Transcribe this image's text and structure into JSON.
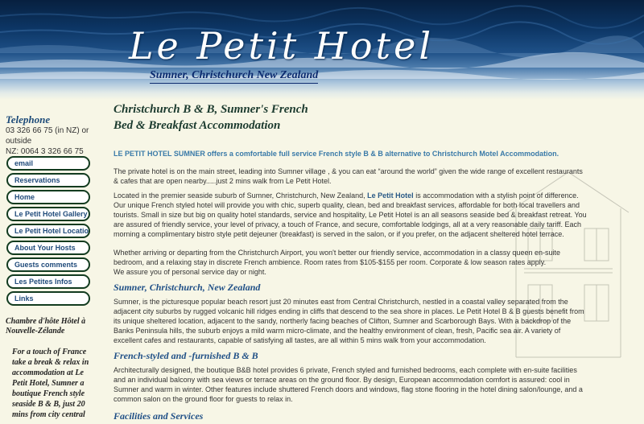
{
  "header": {
    "logo_title": "Le Petit Hotel",
    "logo_subtitle": "Sumner, Christchurch New Zealand"
  },
  "sidebar": {
    "telephone_label": "Telephone",
    "telephone_lines": [
      "03 326 66 75 (in NZ) or outside",
      "NZ: 0064 3 326 66 75"
    ],
    "nav": [
      "email",
      "Reservations",
      "Home",
      "Le Petit Hotel Gallery",
      "Le Petit Hotel Location",
      "About Your Hosts",
      "Guests comments",
      "Les Petites Infos",
      "Links"
    ],
    "chambre": "Chambre d'hôte Hôtel à Nouvelle-Zélande",
    "touch": "For a touch of France take a break & relax in accommodation at Le Petit Hotel, Sumner a boutique French style seaside B & B, just 20 mins from city central"
  },
  "main": {
    "heading_line1": "Christchurch B & B, Sumner's French",
    "heading_line2": "Bed & Breakfast Accommodation",
    "intro": "LE PETIT HOTEL SUMNER offers a comfortable full service French style B & B alternative to Christchurch Motel Accommodation.",
    "p1": "The private hotel is on the main street, leading into Sumner village , & you can eat “around the world” given the wide range of excellent restaurants & cafes that are open nearby.....just 2 mins walk from Le Petit Hotel.",
    "p2a": "Located in the premier seaside suburb of Sumner, Christchurch, New Zealand, ",
    "p2_highlight": "Le Petit Hotel",
    "p2b": " is accommodation with a stylish point of difference. Our unique French styled hotel will provide you with chic, superb quality, clean, bed and breakfast services, affordable for both local travellers and tourists. Small in size but big on quality hotel standards, service and hospitality, Le Petit Hotel is an all seasons seaside bed & breakfast retreat. You are assured of friendly service, your level of privacy, a touch of France, and secure, comfortable lodgings, all at a very reasonable daily tariff. Each morning a complimentary bistro style petit dejeuner (breakfast) is served in the salon, or if you prefer, on the adjacent sheltered hotel terrace.",
    "p3": "Whether arriving or departing from the Christchurch Airport, you won't better our friendly service, accommodation in a classy queen en-suite bedroom, and a relaxing stay in discrete French ambience. Room rates from $105-$155 per room. Corporate & low season rates apply.",
    "p3b": "We assure you of personal service day or night.",
    "h2_sumner": "Sumner, Christchurch, New Zealand",
    "p4": "Sumner, is the picturesque popular beach resort just 20 minutes east from Central Christchurch, nestled in a coastal valley separated from the adjacent city suburbs by rugged volcanic hill ridges ending in cliffs that descend to the sea shore in places. Le Petit Hotel B & B guests benefit from its unique sheltered location, adjacent to the sandy, northerly facing beaches of Clifton, Sumner and Scarborough Bays. With a backdrop of the Banks Peninsula hills, the suburb enjoys a mild warm micro-climate, and the healthy environment of clean, fresh, Pacific sea air. A variety of excellent cafes and restaurants, capable of satisfying all tastes, are all within 5 mins walk from your accommodation.",
    "h2_french": "French-styled and -furnished B & B",
    "p5": "Architecturally designed, the boutique B&B hotel provides 6 private, French styled and furnished bedrooms, each complete with en-suite facilities and an individual balcony with sea views or terrace areas on the ground floor. By design, European accommodation comfort is assured: cool in Sumner and warm in winter. Other features include shuttered French doors and windows, flag stone flooring in the hotel dining salon/lounge, and a common salon on the ground floor for guests to relax in.",
    "h2_facilities": "Facilities and Services"
  }
}
